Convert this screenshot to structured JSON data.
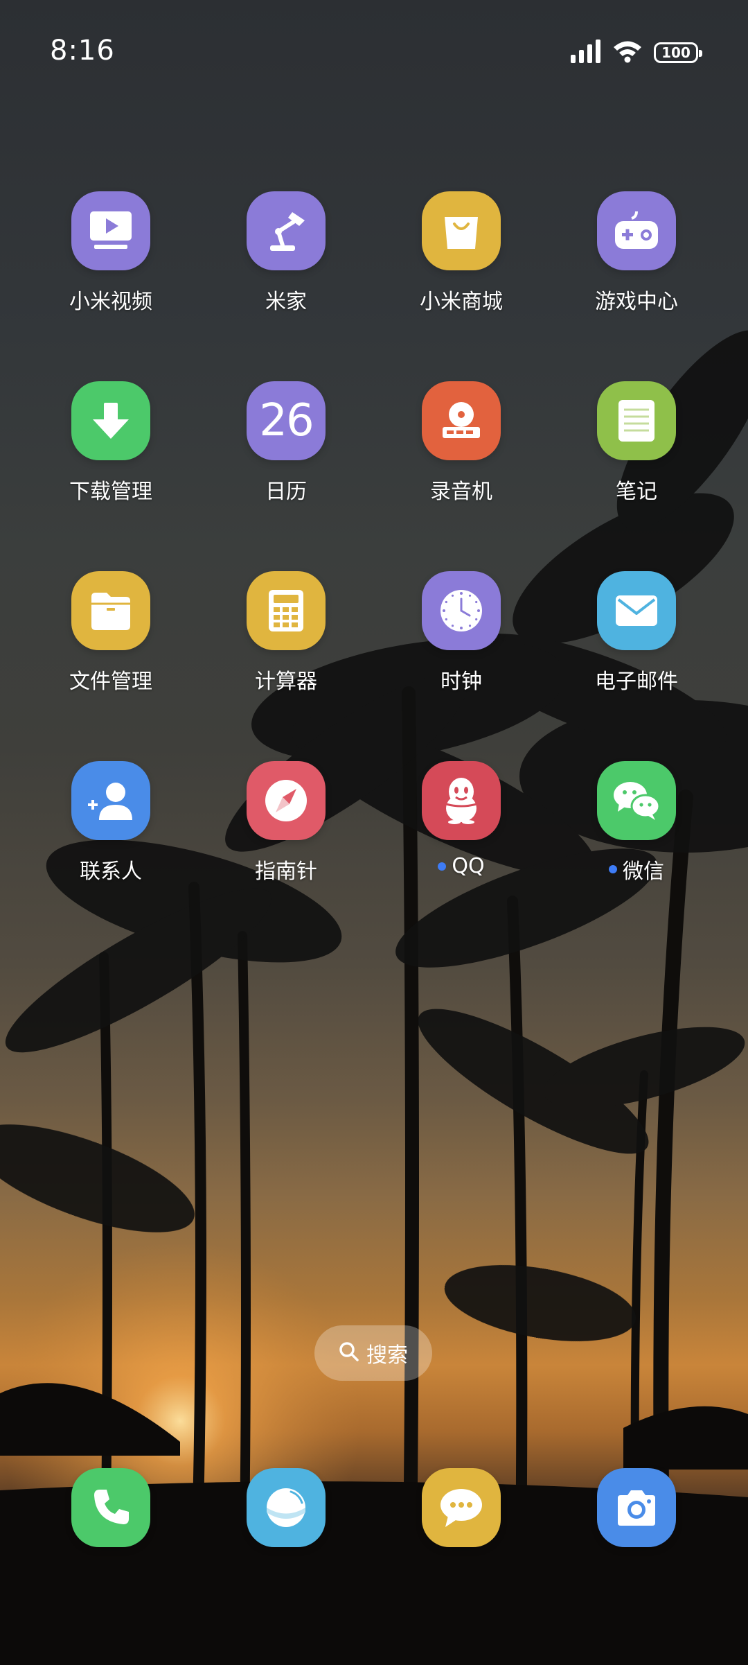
{
  "status_bar": {
    "time": "8:16",
    "battery_level": "100",
    "signal_icon": "cellular-signal-icon",
    "wifi_icon": "wifi-icon"
  },
  "apps": [
    {
      "label": "小米视频",
      "icon": "video-player-icon",
      "color": "#8b7bd8"
    },
    {
      "label": "米家",
      "icon": "desk-lamp-icon",
      "color": "#8b7bd8"
    },
    {
      "label": "小米商城",
      "icon": "shopping-bag-icon",
      "color": "#e0b53f"
    },
    {
      "label": "游戏中心",
      "icon": "gamepad-icon",
      "color": "#8b7bd8"
    },
    {
      "label": "下载管理",
      "icon": "download-arrow-icon",
      "color": "#4cc96a"
    },
    {
      "label": "日历",
      "icon": "calendar-icon",
      "icon_text": "26",
      "color": "#8b7bd8"
    },
    {
      "label": "录音机",
      "icon": "recorder-icon",
      "color": "#e2623e"
    },
    {
      "label": "笔记",
      "icon": "notes-icon",
      "color": "#8fc04a"
    },
    {
      "label": "文件管理",
      "icon": "folder-icon",
      "color": "#e0b53f"
    },
    {
      "label": "计算器",
      "icon": "calculator-icon",
      "color": "#e0b53f"
    },
    {
      "label": "时钟",
      "icon": "clock-icon",
      "color": "#8b7bd8"
    },
    {
      "label": "电子邮件",
      "icon": "envelope-icon",
      "color": "#4fb3e0"
    },
    {
      "label": "联系人",
      "icon": "contact-person-icon",
      "color": "#4a8ce8"
    },
    {
      "label": "指南针",
      "icon": "compass-icon",
      "color": "#e05a68"
    },
    {
      "label": "QQ",
      "icon": "penguin-icon",
      "color": "#d54a58",
      "has_notification": true
    },
    {
      "label": "微信",
      "icon": "wechat-chat-bubbles-icon",
      "color": "#4cc96a",
      "has_notification": true
    }
  ],
  "search": {
    "label": "搜索",
    "icon": "search-icon"
  },
  "dock": [
    {
      "icon": "phone-icon",
      "color": "#4cc96a"
    },
    {
      "icon": "browser-icon",
      "color": "#4fb3e0"
    },
    {
      "icon": "messages-icon",
      "color": "#e0b53f"
    },
    {
      "icon": "camera-icon",
      "color": "#4a8ce8"
    }
  ]
}
